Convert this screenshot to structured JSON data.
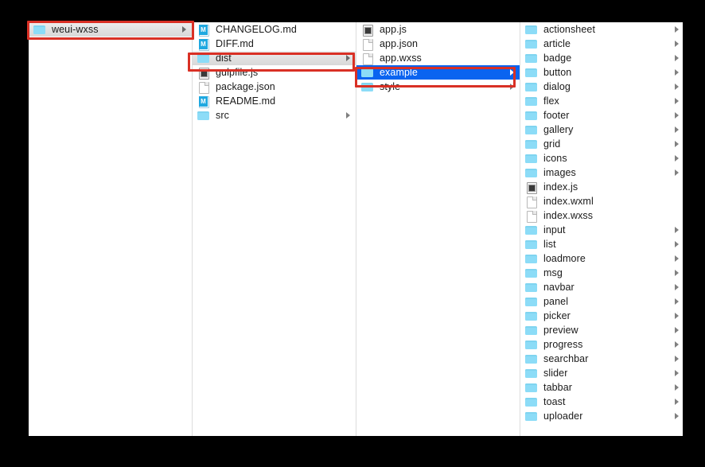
{
  "window": {
    "title": "Finder Column View",
    "background_color": "#000000",
    "content_color": "#ffffff"
  },
  "colors": {
    "annotation_red": "#d93025",
    "selection_blue": "#0a64f0",
    "selection_inactive_gray": "#e2e2e2",
    "folder_blue": "#8cdcf7",
    "markdown_badge_blue": "#1fa8e0"
  },
  "columns": [
    {
      "name": "column-1",
      "items": [
        {
          "label": "weui-wxss",
          "icon": "folder-icon",
          "kind": "folder",
          "has_arrow": true,
          "selected": "inactive",
          "annotated": true
        }
      ]
    },
    {
      "name": "column-2",
      "items": [
        {
          "label": "CHANGELOG.md",
          "icon": "markdown-file-icon",
          "kind": "md",
          "has_arrow": false,
          "selected": "none",
          "annotated": false
        },
        {
          "label": "DIFF.md",
          "icon": "markdown-file-icon",
          "kind": "md",
          "has_arrow": false,
          "selected": "none",
          "annotated": false
        },
        {
          "label": "dist",
          "icon": "folder-icon",
          "kind": "folder",
          "has_arrow": true,
          "selected": "inactive",
          "annotated": true
        },
        {
          "label": "gulpfile.js",
          "icon": "script-file-icon",
          "kind": "js",
          "has_arrow": false,
          "selected": "none",
          "annotated": false
        },
        {
          "label": "package.json",
          "icon": "document-file-icon",
          "kind": "doc",
          "has_arrow": false,
          "selected": "none",
          "annotated": false
        },
        {
          "label": "README.md",
          "icon": "markdown-file-icon",
          "kind": "md",
          "has_arrow": false,
          "selected": "none",
          "annotated": false
        },
        {
          "label": "src",
          "icon": "folder-icon",
          "kind": "folder",
          "has_arrow": true,
          "selected": "none",
          "annotated": false
        }
      ]
    },
    {
      "name": "column-3",
      "items": [
        {
          "label": "app.js",
          "icon": "script-file-icon",
          "kind": "js",
          "has_arrow": false,
          "selected": "none",
          "annotated": false
        },
        {
          "label": "app.json",
          "icon": "document-file-icon",
          "kind": "doc",
          "has_arrow": false,
          "selected": "none",
          "annotated": false
        },
        {
          "label": "app.wxss",
          "icon": "document-file-icon",
          "kind": "doc",
          "has_arrow": false,
          "selected": "none",
          "annotated": false
        },
        {
          "label": "example",
          "icon": "folder-icon",
          "kind": "folder",
          "has_arrow": true,
          "selected": "active",
          "annotated": true
        },
        {
          "label": "style",
          "icon": "folder-icon",
          "kind": "folder",
          "has_arrow": true,
          "selected": "none",
          "annotated": false
        }
      ]
    },
    {
      "name": "column-4",
      "items": [
        {
          "label": "actionsheet",
          "icon": "folder-icon",
          "kind": "folder",
          "has_arrow": true,
          "selected": "none",
          "annotated": false
        },
        {
          "label": "article",
          "icon": "folder-icon",
          "kind": "folder",
          "has_arrow": true,
          "selected": "none",
          "annotated": false
        },
        {
          "label": "badge",
          "icon": "folder-icon",
          "kind": "folder",
          "has_arrow": true,
          "selected": "none",
          "annotated": false
        },
        {
          "label": "button",
          "icon": "folder-icon",
          "kind": "folder",
          "has_arrow": true,
          "selected": "none",
          "annotated": false
        },
        {
          "label": "dialog",
          "icon": "folder-icon",
          "kind": "folder",
          "has_arrow": true,
          "selected": "none",
          "annotated": false
        },
        {
          "label": "flex",
          "icon": "folder-icon",
          "kind": "folder",
          "has_arrow": true,
          "selected": "none",
          "annotated": false
        },
        {
          "label": "footer",
          "icon": "folder-icon",
          "kind": "folder",
          "has_arrow": true,
          "selected": "none",
          "annotated": false
        },
        {
          "label": "gallery",
          "icon": "folder-icon",
          "kind": "folder",
          "has_arrow": true,
          "selected": "none",
          "annotated": false
        },
        {
          "label": "grid",
          "icon": "folder-icon",
          "kind": "folder",
          "has_arrow": true,
          "selected": "none",
          "annotated": false
        },
        {
          "label": "icons",
          "icon": "folder-icon",
          "kind": "folder",
          "has_arrow": true,
          "selected": "none",
          "annotated": false
        },
        {
          "label": "images",
          "icon": "folder-icon",
          "kind": "folder",
          "has_arrow": true,
          "selected": "none",
          "annotated": false
        },
        {
          "label": "index.js",
          "icon": "script-file-icon",
          "kind": "js",
          "has_arrow": false,
          "selected": "none",
          "annotated": false
        },
        {
          "label": "index.wxml",
          "icon": "document-file-icon",
          "kind": "doc",
          "has_arrow": false,
          "selected": "none",
          "annotated": false
        },
        {
          "label": "index.wxss",
          "icon": "document-file-icon",
          "kind": "doc",
          "has_arrow": false,
          "selected": "none",
          "annotated": false
        },
        {
          "label": "input",
          "icon": "folder-icon",
          "kind": "folder",
          "has_arrow": true,
          "selected": "none",
          "annotated": false
        },
        {
          "label": "list",
          "icon": "folder-icon",
          "kind": "folder",
          "has_arrow": true,
          "selected": "none",
          "annotated": false
        },
        {
          "label": "loadmore",
          "icon": "folder-icon",
          "kind": "folder",
          "has_arrow": true,
          "selected": "none",
          "annotated": false
        },
        {
          "label": "msg",
          "icon": "folder-icon",
          "kind": "folder",
          "has_arrow": true,
          "selected": "none",
          "annotated": false
        },
        {
          "label": "navbar",
          "icon": "folder-icon",
          "kind": "folder",
          "has_arrow": true,
          "selected": "none",
          "annotated": false
        },
        {
          "label": "panel",
          "icon": "folder-icon",
          "kind": "folder",
          "has_arrow": true,
          "selected": "none",
          "annotated": false
        },
        {
          "label": "picker",
          "icon": "folder-icon",
          "kind": "folder",
          "has_arrow": true,
          "selected": "none",
          "annotated": false
        },
        {
          "label": "preview",
          "icon": "folder-icon",
          "kind": "folder",
          "has_arrow": true,
          "selected": "none",
          "annotated": false
        },
        {
          "label": "progress",
          "icon": "folder-icon",
          "kind": "folder",
          "has_arrow": true,
          "selected": "none",
          "annotated": false
        },
        {
          "label": "searchbar",
          "icon": "folder-icon",
          "kind": "folder",
          "has_arrow": true,
          "selected": "none",
          "annotated": false
        },
        {
          "label": "slider",
          "icon": "folder-icon",
          "kind": "folder",
          "has_arrow": true,
          "selected": "none",
          "annotated": false
        },
        {
          "label": "tabbar",
          "icon": "folder-icon",
          "kind": "folder",
          "has_arrow": true,
          "selected": "none",
          "annotated": false
        },
        {
          "label": "toast",
          "icon": "folder-icon",
          "kind": "folder",
          "has_arrow": true,
          "selected": "none",
          "annotated": false
        },
        {
          "label": "uploader",
          "icon": "folder-icon",
          "kind": "folder",
          "has_arrow": true,
          "selected": "none",
          "annotated": false
        }
      ]
    }
  ],
  "annotations": [
    {
      "name": "annotation-weui-wxss",
      "target": "weui-wxss"
    },
    {
      "name": "annotation-dist",
      "target": "dist"
    },
    {
      "name": "annotation-example",
      "target": "example"
    }
  ]
}
